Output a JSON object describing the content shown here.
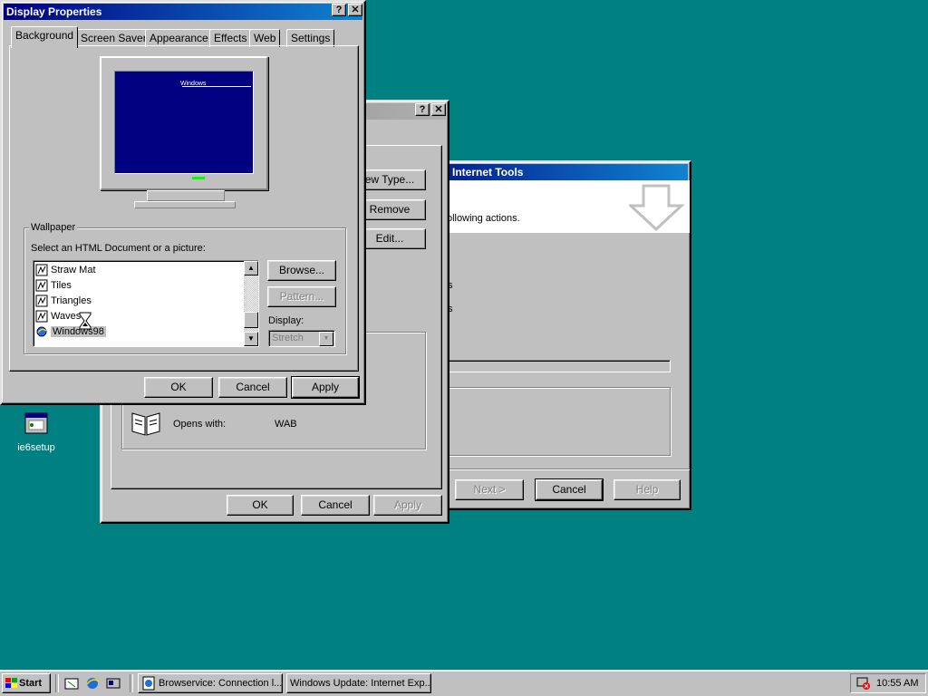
{
  "desktop": {
    "icon_label": "ie6setup"
  },
  "wizard": {
    "title": "Internet Tools",
    "text": "ollowing actions.",
    "label_s1": "s",
    "label_s2": "s",
    "next": "Next >",
    "cancel": "Cancel",
    "help": "Help"
  },
  "middle": {
    "new_type": "ew Type...",
    "remove": "Remove",
    "edit": "Edit...",
    "opens_with_label": "Opens with:",
    "opens_with_value": "WAB",
    "ok": "OK",
    "cancel": "Cancel",
    "apply": "Apply"
  },
  "display": {
    "title": "Display Properties",
    "tabs": [
      "Background",
      "Screen Saver",
      "Appearance",
      "Effects",
      "Web",
      "Settings"
    ],
    "monitor_text": "Windows",
    "wallpaper_group": "Wallpaper",
    "select_label": "Select an HTML Document or a picture:",
    "items": [
      "Straw Mat",
      "Tiles",
      "Triangles",
      "Waves",
      "Windows98"
    ],
    "browse": "Browse...",
    "pattern": "Pattern...",
    "display_label": "Display:",
    "display_value": "Stretch",
    "ok": "OK",
    "cancel": "Cancel",
    "apply": "Apply"
  },
  "taskbar": {
    "start": "Start",
    "task1": "Browservice: Connection l...",
    "task2": "Windows Update: Internet Exp...",
    "clock": "10:55 AM"
  },
  "colors": {
    "desktop": "#008080",
    "title_active": "#000080",
    "selection": "#000080"
  }
}
